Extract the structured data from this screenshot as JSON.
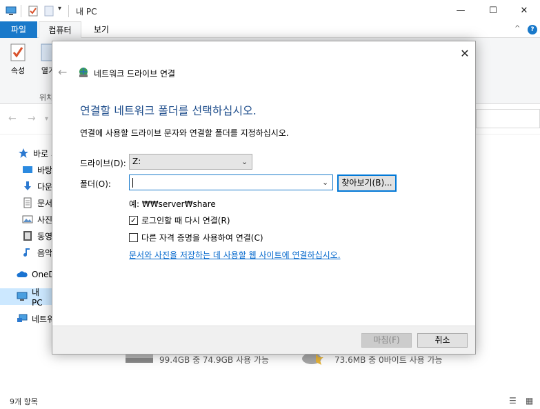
{
  "window": {
    "title": "내 PC",
    "controls": {
      "minimize": "—",
      "maximize": "☐",
      "close": "✕"
    }
  },
  "ribbon": {
    "tabs": {
      "file": "파일",
      "computer": "컴퓨터",
      "view": "보기"
    },
    "buttons": {
      "properties": "속성",
      "open": "열기"
    },
    "group_label": "위치",
    "collapse_icon": "^",
    "help": "?"
  },
  "sidebar": {
    "items": [
      {
        "label": "바로 가",
        "icon": "star-icon"
      },
      {
        "label": "바탕",
        "icon": "desktop-icon"
      },
      {
        "label": "다운",
        "icon": "download-icon"
      },
      {
        "label": "문서",
        "icon": "document-icon"
      },
      {
        "label": "사진",
        "icon": "picture-icon"
      },
      {
        "label": "동영",
        "icon": "video-icon"
      },
      {
        "label": "음악",
        "icon": "music-icon"
      },
      {
        "label": "OneD",
        "icon": "cloud-icon"
      },
      {
        "label": "내 PC",
        "icon": "pc-icon"
      },
      {
        "label": "네트워",
        "icon": "network-icon"
      }
    ]
  },
  "content": {
    "drive1": "99.4GB 중 74.9GB 사용 가능",
    "drive2": "73.6MB 중 0바이트 사용 가능"
  },
  "status": {
    "item_count": "9개 항목"
  },
  "dialog": {
    "title": "네트워크 드라이브 연결",
    "heading": "연결할 네트워크 폴더를 선택하십시오.",
    "description": "연결에 사용할 드라이브 문자와 연결할 폴더를 지정하십시오.",
    "drive_label": "드라이브(D):",
    "drive_value": "Z:",
    "folder_label": "폴더(O):",
    "folder_value": "",
    "browse_button": "찾아보기(B)...",
    "example": "예: ₩₩server₩share",
    "reconnect_label": "로그인할 때 다시 연결(R)",
    "reconnect_checked": true,
    "other_credentials_label": "다른 자격 증명을 사용하여 연결(C)",
    "other_credentials_checked": false,
    "link": "문서와 사진을 저장하는 데 사용할 웹 사이트에 연결하십시오.",
    "finish_button": "마침(F)",
    "cancel_button": "취소"
  }
}
